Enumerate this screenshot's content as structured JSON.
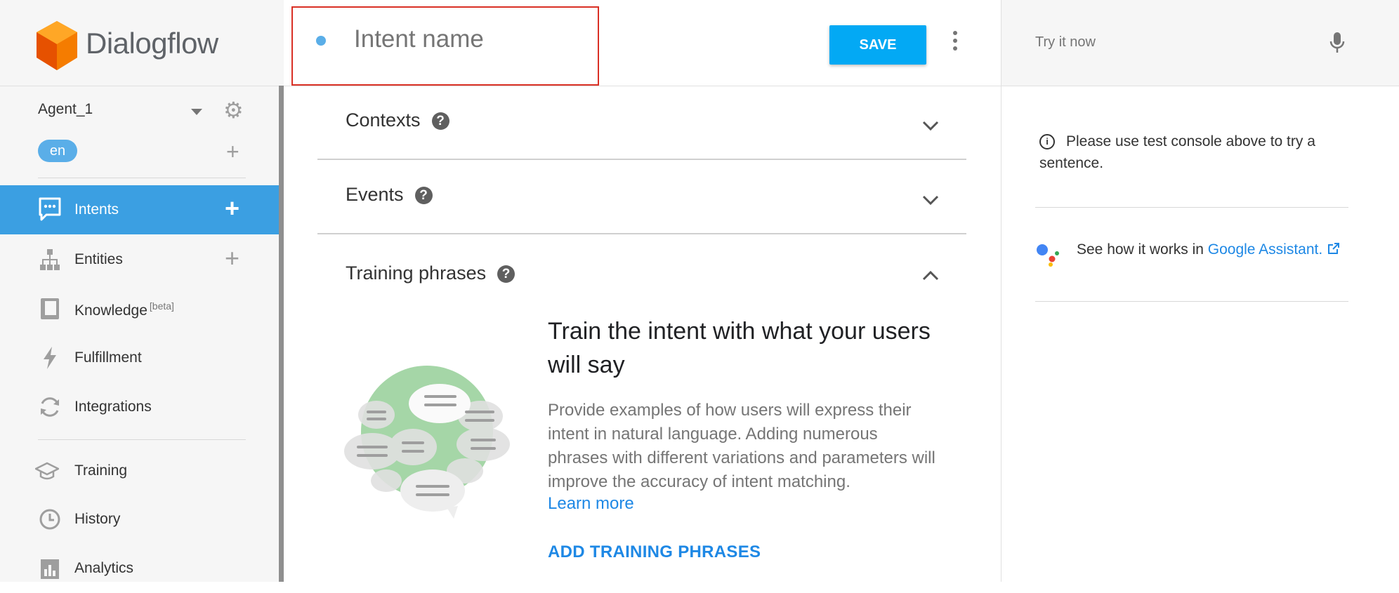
{
  "brand": {
    "name": "Dialogflow"
  },
  "agent": {
    "name": "Agent_1",
    "language": "en"
  },
  "nav": {
    "intents": "Intents",
    "entities": "Entities",
    "knowledge": "Knowledge",
    "knowledge_badge": "[beta]",
    "fulfillment": "Fulfillment",
    "integrations": "Integrations",
    "training": "Training",
    "history": "History",
    "analytics": "Analytics"
  },
  "editor": {
    "intent_name_placeholder": "Intent name",
    "save_label": "SAVE",
    "sections": {
      "contexts": "Contexts",
      "events": "Events",
      "training_phrases": "Training phrases"
    },
    "training": {
      "title": "Train the intent with what your users will say",
      "description": "Provide examples of how users will express their intent in natural language. Adding numerous phrases with different variations and parameters will improve the accuracy of intent matching.",
      "learn_more": "Learn more",
      "add_button": "ADD TRAINING PHRASES"
    }
  },
  "console": {
    "try_placeholder": "Try it now",
    "info_text": "Please use test console above to try a sentence.",
    "assistant_text": "See how it works in ",
    "assistant_link": "Google Assistant."
  },
  "colors": {
    "accent": "#3b9fe2",
    "save": "#03a9f4",
    "link": "#1e88e5",
    "highlight_border": "#d93025"
  }
}
